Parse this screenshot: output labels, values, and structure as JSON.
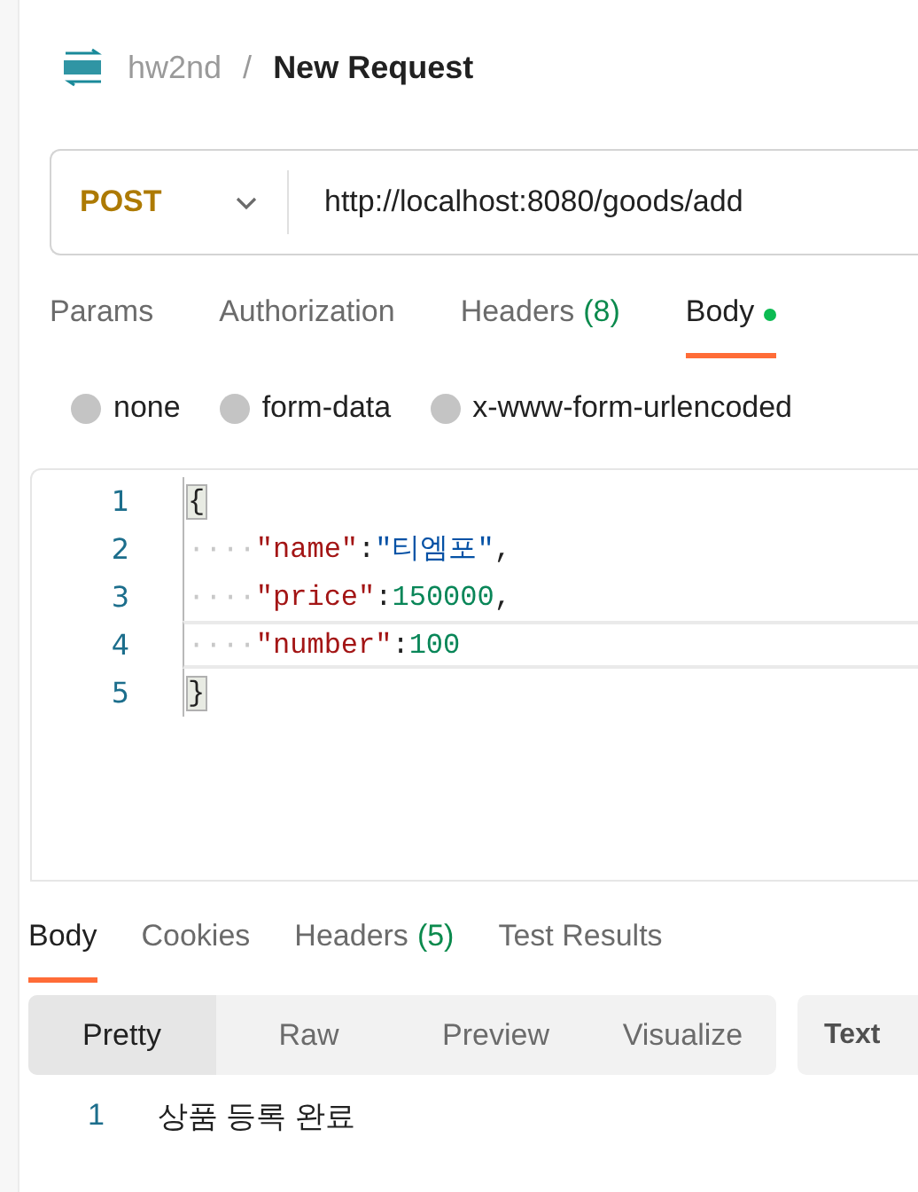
{
  "breadcrumb": {
    "collection": "hw2nd",
    "separator": "/",
    "request": "New Request"
  },
  "request": {
    "method": "POST",
    "url": "http://localhost:8080/goods/add"
  },
  "request_tabs": [
    {
      "label": "Params",
      "selected": false
    },
    {
      "label": "Authorization",
      "selected": false
    },
    {
      "label": "Headers",
      "count": "(8)",
      "selected": false
    },
    {
      "label": "Body",
      "selected": true,
      "dot": true
    }
  ],
  "body_types": [
    {
      "label": "none",
      "selected": false
    },
    {
      "label": "form-data",
      "selected": false
    },
    {
      "label": "x-www-form-urlencoded",
      "selected": false
    }
  ],
  "editor": {
    "lines": [
      {
        "number": "1",
        "active": false,
        "tokens": [
          {
            "kind": "bracket",
            "text": "{",
            "matched": true
          }
        ]
      },
      {
        "number": "2",
        "active": false,
        "tokens": [
          {
            "kind": "indent",
            "text": "····"
          },
          {
            "kind": "key",
            "text": "\"name\""
          },
          {
            "kind": "punct",
            "text": ":"
          },
          {
            "kind": "string",
            "text": "\"티엠포\""
          },
          {
            "kind": "punct",
            "text": ","
          }
        ]
      },
      {
        "number": "3",
        "active": false,
        "tokens": [
          {
            "kind": "indent",
            "text": "····"
          },
          {
            "kind": "key",
            "text": "\"price\""
          },
          {
            "kind": "punct",
            "text": ":"
          },
          {
            "kind": "number",
            "text": "150000"
          },
          {
            "kind": "punct",
            "text": ","
          }
        ]
      },
      {
        "number": "4",
        "active": true,
        "tokens": [
          {
            "kind": "indent",
            "text": "····"
          },
          {
            "kind": "key",
            "text": "\"number\""
          },
          {
            "kind": "punct",
            "text": ":"
          },
          {
            "kind": "number",
            "text": "100"
          }
        ]
      },
      {
        "number": "5",
        "active": false,
        "tokens": [
          {
            "kind": "bracket",
            "text": "}",
            "matched": true
          }
        ]
      }
    ]
  },
  "response_tabs": [
    {
      "label": "Body",
      "selected": true
    },
    {
      "label": "Cookies",
      "selected": false
    },
    {
      "label": "Headers",
      "count": "(5)",
      "selected": false
    },
    {
      "label": "Test Results",
      "selected": false
    }
  ],
  "view_modes": [
    {
      "label": "Pretty",
      "selected": true
    },
    {
      "label": "Raw",
      "selected": false
    },
    {
      "label": "Preview",
      "selected": false
    },
    {
      "label": "Visualize",
      "selected": false
    }
  ],
  "format": "Text",
  "response_lines": [
    {
      "number": "1",
      "text": "상품 등록 완료"
    }
  ]
}
